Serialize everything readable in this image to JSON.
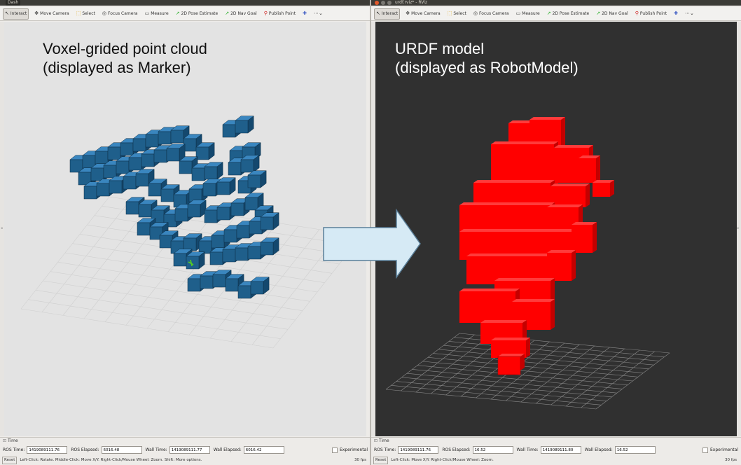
{
  "left": {
    "title": "Dash",
    "toolbar": [
      "Interact",
      "Move Camera",
      "Select",
      "Focus Camera",
      "Measure",
      "2D Pose Estimate",
      "2D Nav Goal",
      "Publish Point"
    ],
    "caption_line1": "Voxel-grided point cloud",
    "caption_line2": "(displayed as Marker)",
    "time_header": "Time",
    "ros_time_label": "ROS Time:",
    "ros_time": "1419089111.76",
    "ros_elapsed_label": "ROS Elapsed:",
    "ros_elapsed": "6016.48",
    "wall_time_label": "Wall Time:",
    "wall_time": "1419089111.77",
    "wall_elapsed_label": "Wall Elapsed:",
    "wall_elapsed": "6016.42",
    "experimental": "Experimental",
    "reset": "Reset",
    "status": "Left-Click: Rotate. Middle-Click: Move X/Y. Right-Click/Mouse Wheel: Zoom. Shift: More options.",
    "fps": "30 fps"
  },
  "right": {
    "title": "urdf.rviz* - RViz",
    "toolbar": [
      "Interact",
      "Move Camera",
      "Select",
      "Focus Camera",
      "Measure",
      "2D Pose Estimate",
      "2D Nav Goal",
      "Publish Point"
    ],
    "caption_line1": "URDF model",
    "caption_line2": "(displayed as RobotModel)",
    "time_header": "Time",
    "ros_time_label": "ROS Time:",
    "ros_time": "1419089111.76",
    "ros_elapsed_label": "ROS Elapsed:",
    "ros_elapsed": "16.52",
    "wall_time_label": "Wall Time:",
    "wall_time": "1419089111.80",
    "wall_elapsed_label": "Wall Elapsed:",
    "wall_elapsed": "16.52",
    "experimental": "Experimental",
    "reset": "Reset",
    "status": "Left-Click: Move X/Y. Right-Click/Mouse Wheel: Zoom.",
    "fps": "30 fps"
  },
  "colors": {
    "voxel": "#1f5f8b",
    "robot": "#ff0000",
    "arrow": "#d6eaf5"
  },
  "icons": [
    "cursor-icon",
    "camera-icon",
    "select-icon",
    "focus-icon",
    "ruler-icon",
    "pose-arrow-icon",
    "goal-arrow-icon",
    "pin-icon"
  ]
}
